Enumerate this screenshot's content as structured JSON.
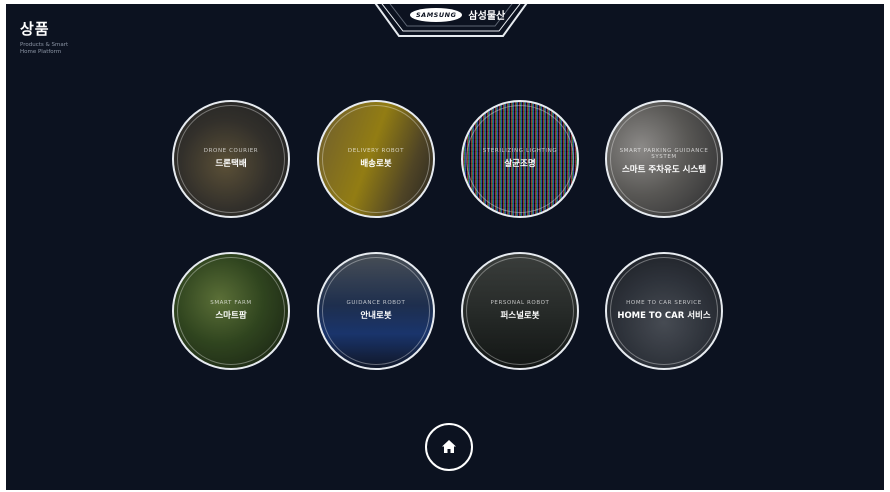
{
  "header": {
    "title": "상품",
    "subtitle": "Products & Smart Home Platform"
  },
  "brand": {
    "logo_text": "SAMSUNG",
    "name": "삼성물산"
  },
  "products": [
    {
      "sub": "DRONE COURIER",
      "label": "드론택배"
    },
    {
      "sub": "DELIVERY ROBOT",
      "label": "배송로봇"
    },
    {
      "sub": "STERILIZING LIGHTING",
      "label": "살균조명"
    },
    {
      "sub": "SMART PARKING GUIDANCE SYSTEM",
      "label": "스마트 주차유도 시스템"
    },
    {
      "sub": "SMART FARM",
      "label": "스마트팜"
    },
    {
      "sub": "GUIDANCE ROBOT",
      "label": "안내로봇"
    },
    {
      "sub": "PERSONAL ROBOT",
      "label": "퍼스널로봇"
    },
    {
      "sub": "HOME TO CAR SERVICE",
      "label": "HOME TO CAR 서비스"
    }
  ],
  "home": {
    "icon": "home-icon"
  },
  "colors": {
    "background": "#0c1220",
    "accent": "#ffffff"
  }
}
